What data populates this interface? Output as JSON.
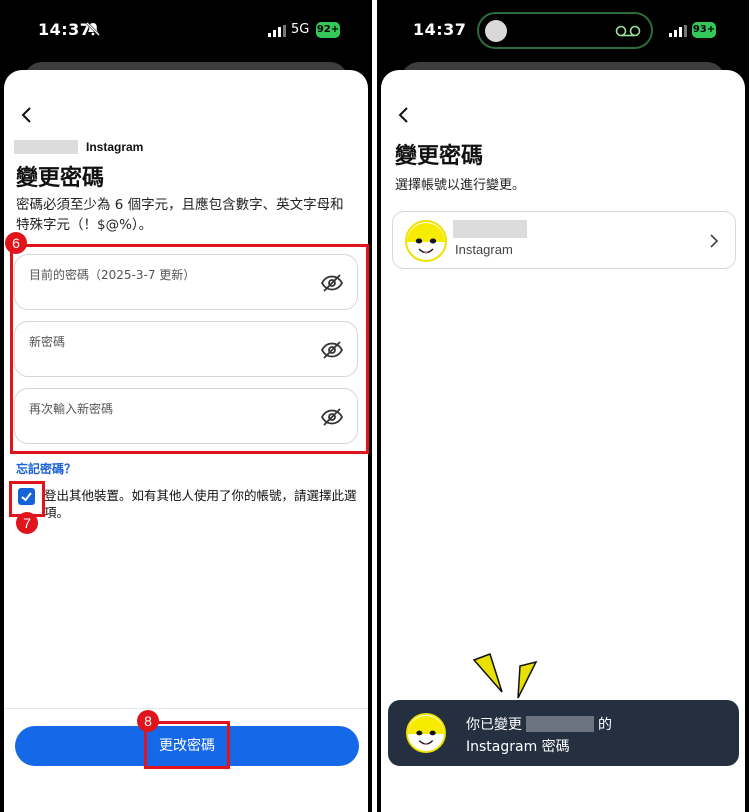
{
  "left_screen": {
    "status": {
      "time": "14:37",
      "network": "5G",
      "battery": "92+"
    },
    "account_label": "Instagram",
    "title": "變更密碼",
    "description": "密碼必須至少為 6 個字元，且應包含數字、英文字母和特殊字元（！$@%）。",
    "fields": [
      {
        "placeholder": "目前的密碼（2025-3-7 更新）"
      },
      {
        "placeholder": "新密碼"
      },
      {
        "placeholder": "再次輸入新密碼"
      }
    ],
    "forgot_link": "忘記密碼？",
    "logout_checkbox": {
      "checked": true,
      "label": "登出其他裝置。如有其他人使用了你的帳號，請選擇此選項。"
    },
    "submit_label": "更改密碼",
    "steps": [
      "6",
      "7",
      "8"
    ],
    "highlight_color": "#e0141a",
    "accent_color": "#1568e8"
  },
  "right_screen": {
    "status": {
      "time": "14:37",
      "battery": "93+"
    },
    "title": "變更密碼",
    "subtitle": "選擇帳號以進行變更。",
    "account_card": {
      "label": "Instagram"
    },
    "toast": {
      "prefix": "你已變更",
      "suffix": "的",
      "line2": "Instagram 密碼"
    }
  },
  "icons": [
    "back-chevron-icon",
    "silent-bell-icon",
    "signal-icon",
    "eye-off-icon",
    "checkmark-icon",
    "chevron-right-icon",
    "voicemail-icon",
    "smiley-avatar-icon",
    "sparkle-icon"
  ]
}
